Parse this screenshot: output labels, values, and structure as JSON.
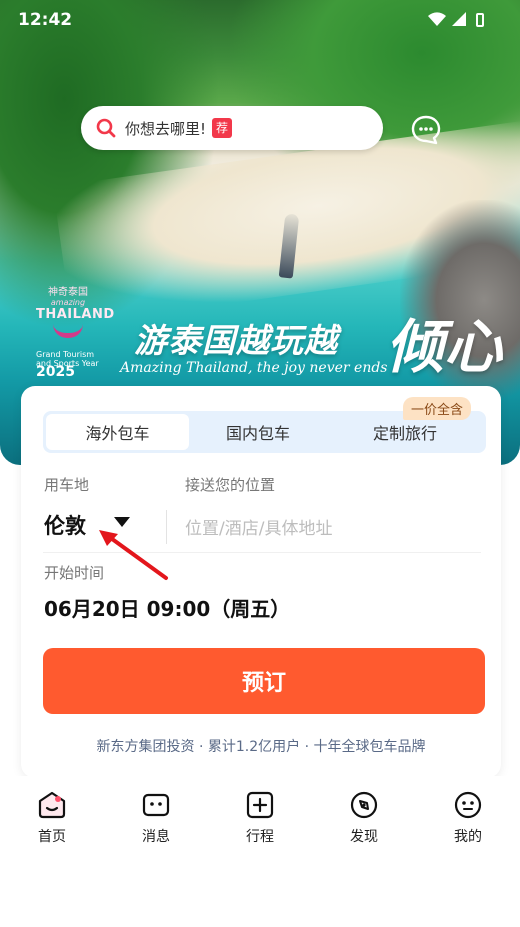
{
  "status_bar": {
    "time": "12:42"
  },
  "hero": {
    "search_placeholder": "你想去哪里!",
    "search_tag": "荐",
    "logo": {
      "cn": "神奇泰国",
      "amazing": "amazing",
      "th": "THAILAND",
      "gt_line1": "Grand Tourism",
      "gt_line2": "and Sports Year",
      "year": "2025"
    },
    "slogan": "游泰国越玩越",
    "slogan_big": "倾心",
    "slogan_en": "Amazing Thailand, the joy never ends"
  },
  "booking": {
    "tabs": [
      {
        "label": "海外包车"
      },
      {
        "label": "国内包车"
      },
      {
        "label": "定制旅行"
      }
    ],
    "badge": "一价全含",
    "pickup_city_label": "用车地",
    "pickup_city": "伦敦",
    "location_label": "接送您的位置",
    "location_placeholder": "位置/酒店/具体地址",
    "start_time_label": "开始时间",
    "start_time": "06月20日 09:00（周五）",
    "book_button": "预订",
    "footer_slogan": "新东方集团投资 · 累计1.2亿用户 · 十年全球包车品牌"
  },
  "nav": [
    {
      "label": "首页",
      "icon": "home-icon"
    },
    {
      "label": "消息",
      "icon": "message-icon"
    },
    {
      "label": "行程",
      "icon": "itinerary-icon"
    },
    {
      "label": "发现",
      "icon": "discover-icon"
    },
    {
      "label": "我的",
      "icon": "profile-icon"
    }
  ],
  "colors": {
    "accent": "#ff5a2f",
    "tab_bg": "#e6f1fd",
    "badge_bg": "#fde2c4",
    "tag_red": "#f2384a"
  }
}
